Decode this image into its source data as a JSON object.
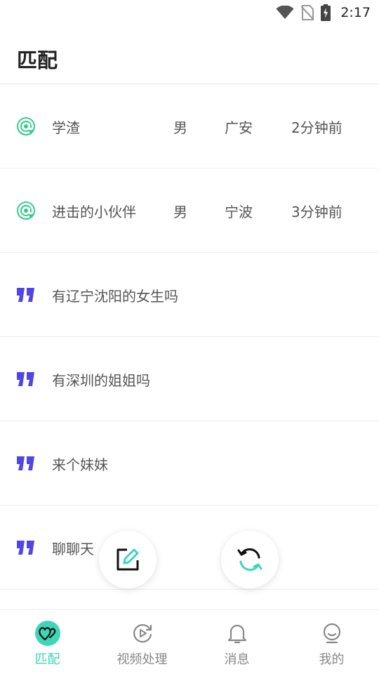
{
  "status_bar": {
    "time": "2:17"
  },
  "header": {
    "title": "匹配"
  },
  "list": [
    {
      "type": "at",
      "text": "学渣",
      "gender": "男",
      "city": "广安",
      "time": "2分钟前"
    },
    {
      "type": "at",
      "text": "进击的小伙伴",
      "gender": "男",
      "city": "宁波",
      "time": "3分钟前"
    },
    {
      "type": "quote",
      "text": "有辽宁沈阳的女生吗"
    },
    {
      "type": "quote",
      "text": "有深圳的姐姐吗"
    },
    {
      "type": "quote",
      "text": "来个妹妹"
    },
    {
      "type": "quote",
      "text": "聊聊天"
    }
  ],
  "tabs": [
    {
      "label": "匹配",
      "icon": "hearts-icon",
      "active": true
    },
    {
      "label": "视频处理",
      "icon": "video-replay-icon",
      "active": false
    },
    {
      "label": "消息",
      "icon": "bell-icon",
      "active": false
    },
    {
      "label": "我的",
      "icon": "profile-icon",
      "active": false
    }
  ],
  "colors": {
    "accent": "#3fd6b8",
    "at_icon": "#2ecc8a",
    "quote_icon": "#4f46e5"
  }
}
